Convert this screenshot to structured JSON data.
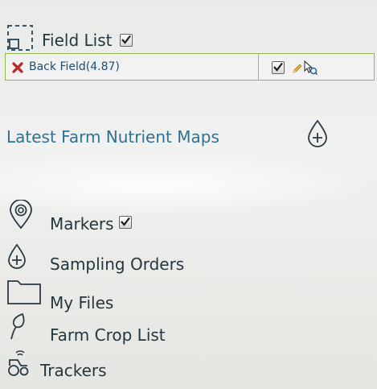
{
  "field_list": {
    "title": "Field List",
    "checked": true,
    "fields": [
      {
        "name": "Back Field(4.87)",
        "checked": true
      }
    ]
  },
  "nutrient_maps": {
    "label": "Latest Farm Nutrient Maps"
  },
  "menu": {
    "markers": "Markers",
    "sampling_orders": "Sampling Orders",
    "my_files": "My Files",
    "farm_crop_list": "Farm Crop List",
    "trackers": "Trackers"
  },
  "icons": {
    "field_list": "dashed-selection-icon",
    "delete": "red-x-icon",
    "edit": "pencil-icon",
    "zoom": "zoom-to-field-icon",
    "nutrient_add": "drop-plus-icon",
    "markers": "map-pin-icon",
    "sampling_orders": "drop-plus-icon",
    "my_files": "folder-icon",
    "farm_crop_list": "leaf-icon",
    "trackers": "tractor-icon"
  },
  "colors": {
    "link": "#2f7193",
    "field_name": "#1d4f78",
    "row_border": "#9ab84d",
    "delete": "#c4241c",
    "text": "#25363f"
  }
}
